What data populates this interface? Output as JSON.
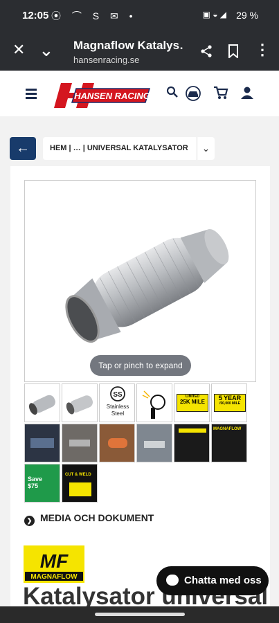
{
  "status": {
    "time": "12:05",
    "left_icons": "⦿ ⌒ S ✉ •",
    "battery": "29 %"
  },
  "browser": {
    "title": "Magnaflow Katalys…",
    "url": "hansenracing.se",
    "close_icon": "✕",
    "collapse_icon": "⌄",
    "share_icon": "share-icon",
    "bookmark_icon": "bookmark-icon",
    "menu_icon": "⋮"
  },
  "site": {
    "logo_text": "HANSEN RACING"
  },
  "breadcrumb": {
    "back_icon": "←",
    "text": "HEM  | … | UNIVERSAL KATALYSATOR",
    "chevron": "⌄"
  },
  "gallery": {
    "expand_hint": "Tap or pinch to expand",
    "thumb_texts": {
      "steel": "Stainless Steel",
      "warranty_miles": "25K MILE",
      "warranty_limited": "LIMITED",
      "warranty_years": "5 YEAR",
      "warranty_years_sub": "/50,000 MILE",
      "save": "Save $75",
      "cut_weld": "CUT & WELD",
      "magnaflow_small": "MAGNAFLOW"
    }
  },
  "media_section": {
    "label": "MEDIA OCH DOKUMENT"
  },
  "brand": {
    "logo_text": "MAGNAFLOW"
  },
  "product": {
    "title": "Katalysator universal"
  },
  "chat": {
    "label": "Chatta med oss"
  },
  "colors": {
    "topbar": "#2b2d31",
    "navy": "#183b6b",
    "brand_red": "#d4161f",
    "brand_blue": "#1b2b6b",
    "mf_yellow": "#f5e400"
  }
}
